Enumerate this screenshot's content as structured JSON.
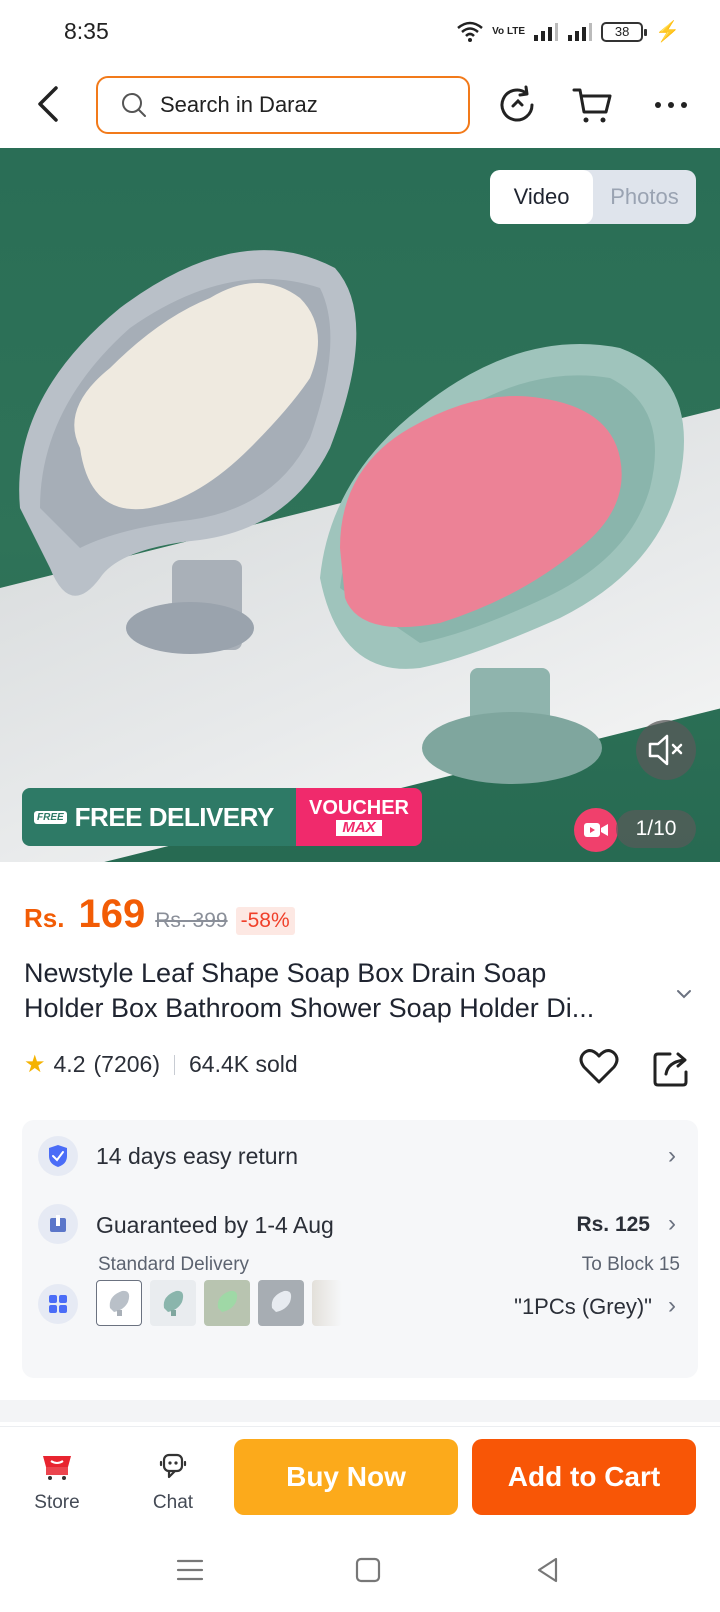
{
  "status_bar": {
    "time": "8:35",
    "network_label": "Vo LTE",
    "battery_level": "38"
  },
  "search": {
    "placeholder": "Search in Daraz"
  },
  "gallery": {
    "tabs": [
      {
        "label": "Video",
        "active": true
      },
      {
        "label": "Photos",
        "active": false
      }
    ],
    "page_indicator": "1/10",
    "promo": {
      "free_badge": "FREE",
      "free_delivery": "FREE DELIVERY",
      "voucher_line1": "VOUCHER",
      "voucher_line2": "MAX"
    }
  },
  "product": {
    "currency": "Rs.",
    "price": "169",
    "original_price": "Rs. 399",
    "discount": "-58%",
    "title_line1": "Newstyle Leaf Shape Soap Box Drain Soap",
    "title_line2": "Holder Box Bathroom Shower Soap Holder Di...",
    "rating": "4.2",
    "reviews": "(7206)",
    "sold": "64.4K sold"
  },
  "info": {
    "return_policy": "14 days easy return",
    "delivery_guarantee": "Guaranteed by 1-4 Aug",
    "delivery_type": "Standard Delivery",
    "delivery_price": "Rs. 125",
    "delivery_location": "To Block 15",
    "selected_variant": "\"1PCs (Grey)\""
  },
  "action_bar": {
    "store_label": "Store",
    "chat_label": "Chat",
    "buy_now_label": "Buy Now",
    "add_to_cart_label": "Add to Cart"
  },
  "colors": {
    "brand_orange": "#f85606",
    "buy_now_yellow": "#fcaa1b",
    "price_orange": "#f25c05",
    "search_border": "#f27a1a"
  }
}
